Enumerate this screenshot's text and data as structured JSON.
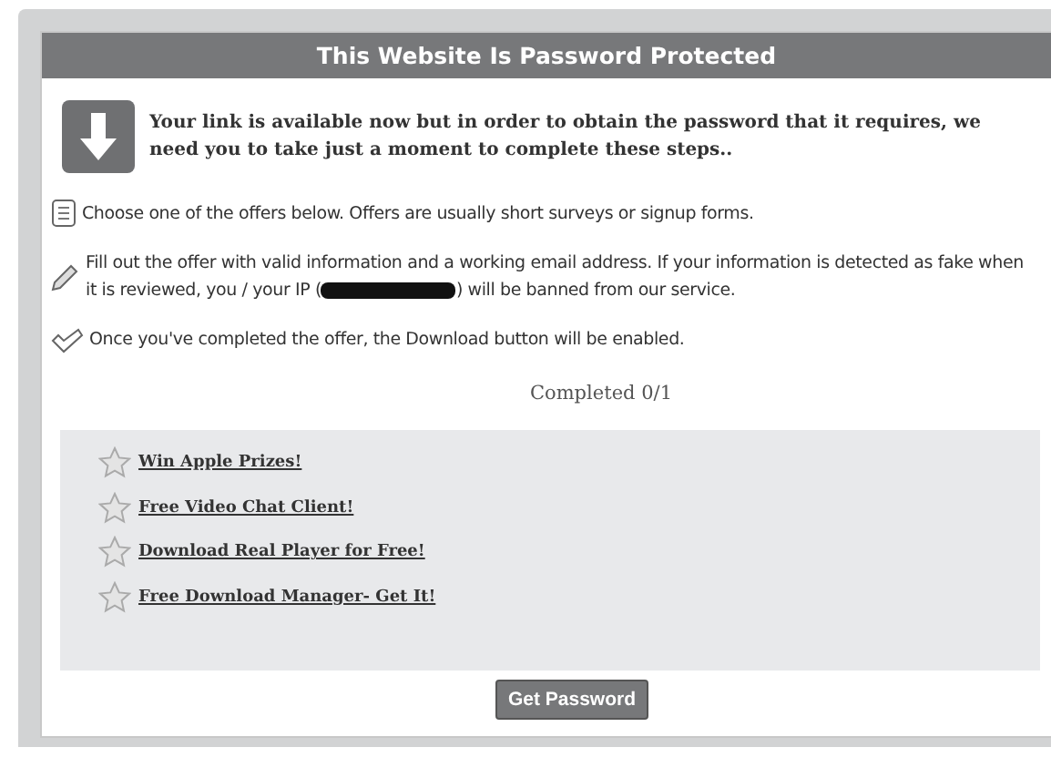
{
  "title": "This Website Is Password Protected",
  "intro": "Your link is available now but in order to obtain the password that it requires, we need you to take just a moment to complete these steps..",
  "steps": [
    {
      "kind": "list",
      "text": "Choose one of the offers below. Offers are usually short surveys or signup forms."
    },
    {
      "kind": "pencil",
      "text": "Fill out the offer with valid information and a working email address. If your information is detected as fake when it is reviewed, you / your IP (",
      "text_after": ") will be banned from our service."
    },
    {
      "kind": "check",
      "text": "Once you've completed the offer, the Download button will be enabled."
    }
  ],
  "progress": "Completed 0/1",
  "offers": [
    "Win Apple Prizes!",
    "Free Video Chat Client!",
    "Download Real Player for Free!",
    "Free Download Manager- Get It!"
  ],
  "button": "Get Password"
}
